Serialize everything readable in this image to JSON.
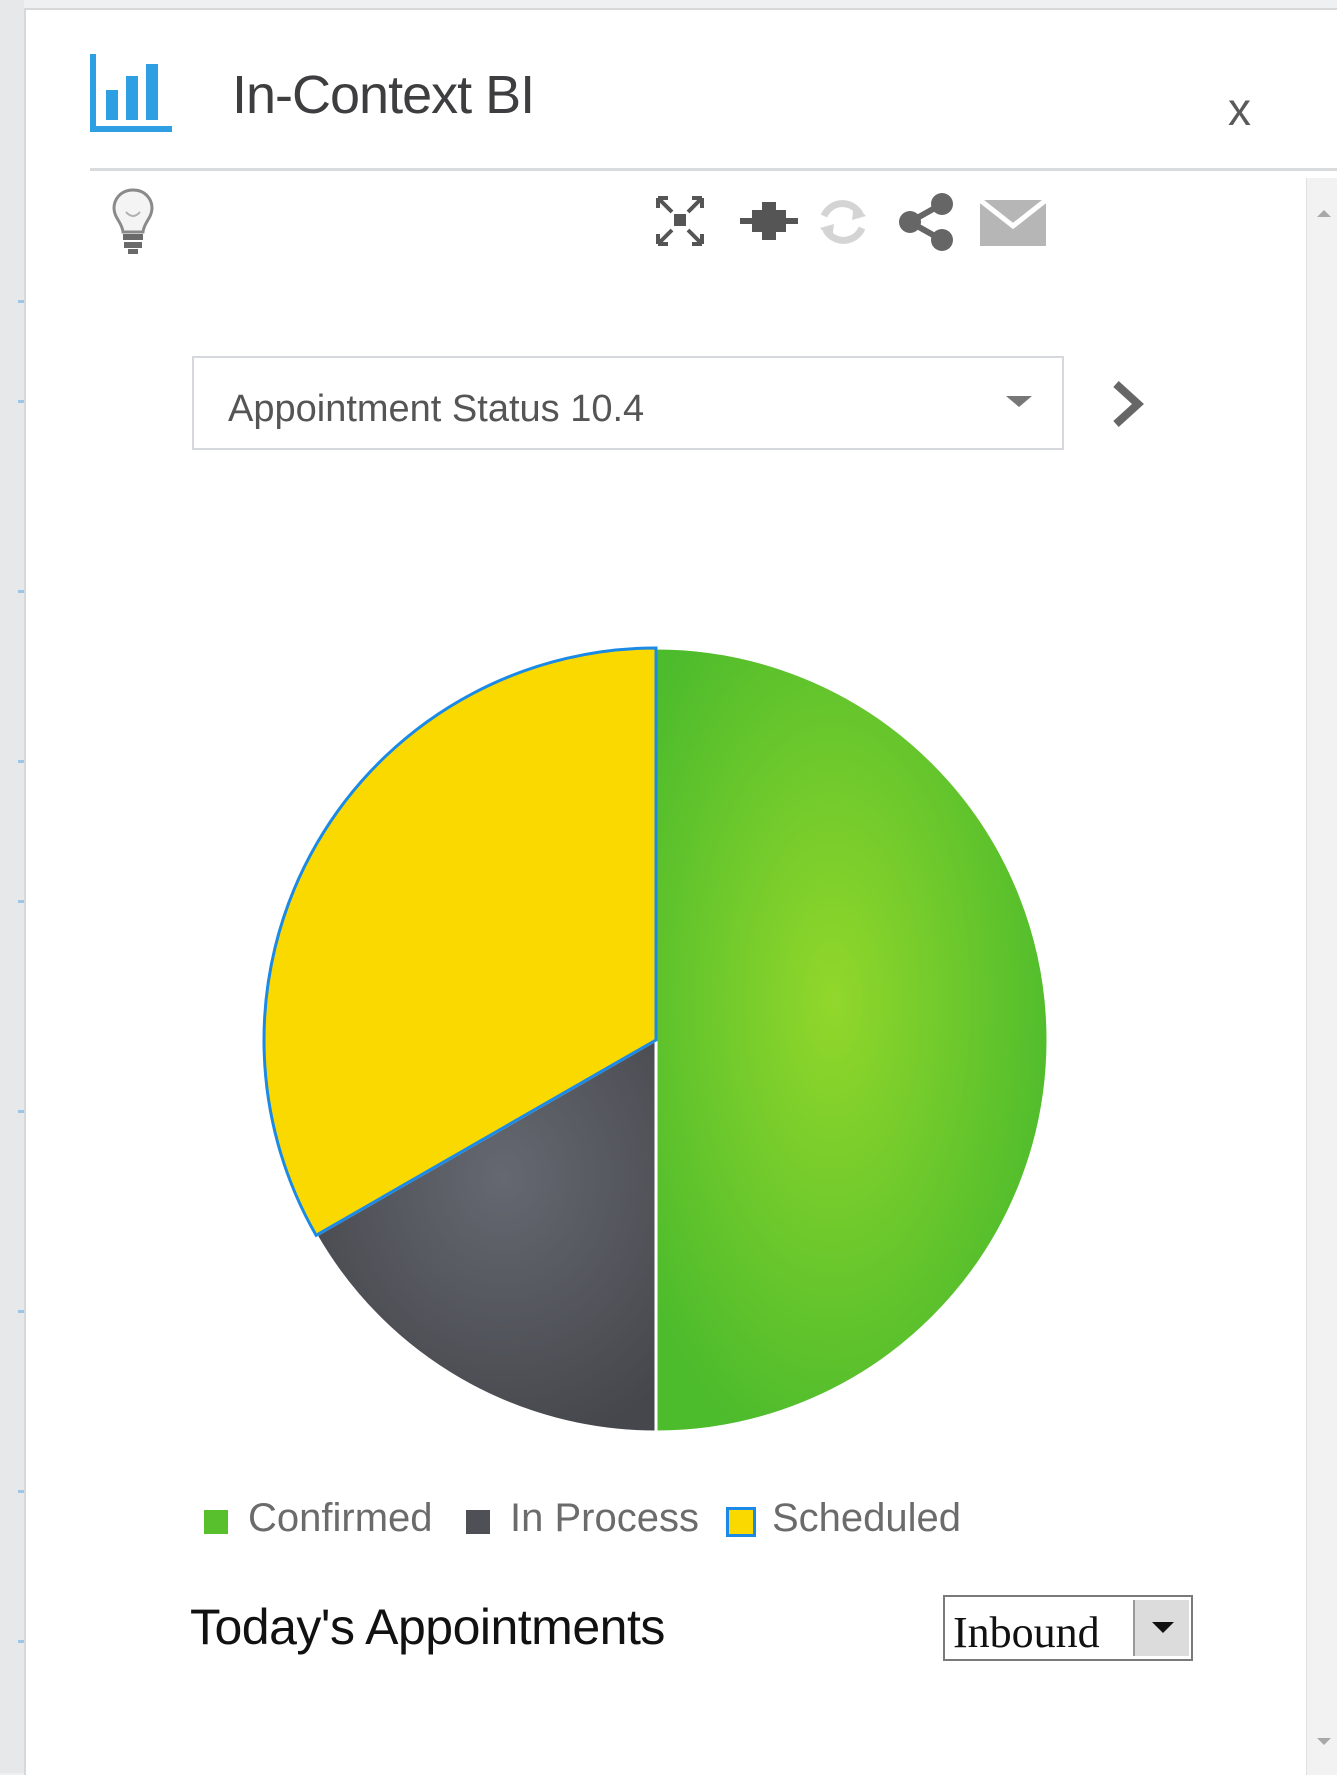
{
  "window": {
    "title": "In-Context BI",
    "close_label": "x"
  },
  "toolbar": {
    "icons": [
      "lightbulb-icon",
      "fullscreen-icon",
      "pin-icon",
      "refresh-icon",
      "share-icon",
      "email-icon"
    ]
  },
  "report_selector": {
    "value": "Appointment Status 10.4"
  },
  "chart_data": {
    "type": "pie",
    "title": "",
    "slices": [
      {
        "label": "Confirmed",
        "value": 50,
        "color": "#59c02d"
      },
      {
        "label": "In Process",
        "value": 16.7,
        "color": "#4e5056"
      },
      {
        "label": "Scheduled",
        "value": 33.3,
        "color": "#fad900"
      }
    ],
    "legend": {
      "placement": "bottom",
      "entries": [
        "Confirmed",
        "In Process",
        "Scheduled"
      ]
    }
  },
  "footer": {
    "title": "Today's Appointments",
    "direction_value": "Inbound"
  },
  "colors": {
    "accent": "#2e9fe3",
    "selected_border": "#1a8ae6"
  }
}
